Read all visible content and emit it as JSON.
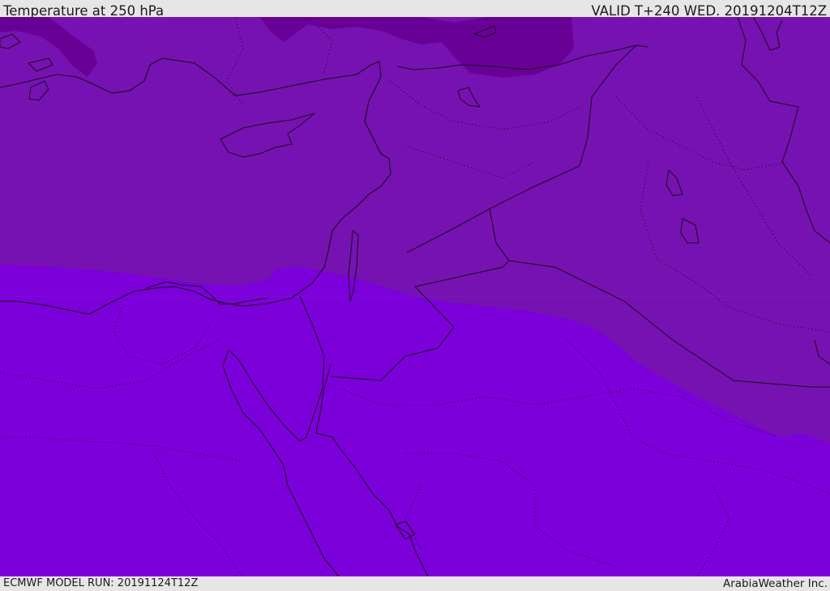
{
  "header": {
    "title": "Temperature at 250 hPa",
    "valid": "VALID T+240 WED. 20191204T12Z"
  },
  "footer": {
    "model_run": "ECMWF MODEL RUN: 20191124T12Z",
    "credit": "ArabiaWeather Inc."
  },
  "colors": {
    "background_bar": "#e6e6e6",
    "warm_band": "#7b00d9",
    "mid_band": "#7612b2",
    "cold_band": "#690096",
    "border_line": "#1a0a1a"
  }
}
